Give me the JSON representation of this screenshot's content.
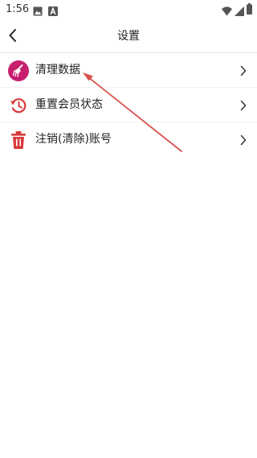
{
  "status_bar": {
    "time": "1:56"
  },
  "header": {
    "title": "设置"
  },
  "settings": {
    "items": [
      {
        "label": "清理数据",
        "icon": "broom-icon"
      },
      {
        "label": "重置会员状态",
        "icon": "history-icon"
      },
      {
        "label": "注销(清除)账号",
        "icon": "trash-icon"
      }
    ]
  },
  "colors": {
    "accent_red": "#d93a3a",
    "broom_bg": "#c81e6e",
    "annotation": "#d9534f"
  }
}
